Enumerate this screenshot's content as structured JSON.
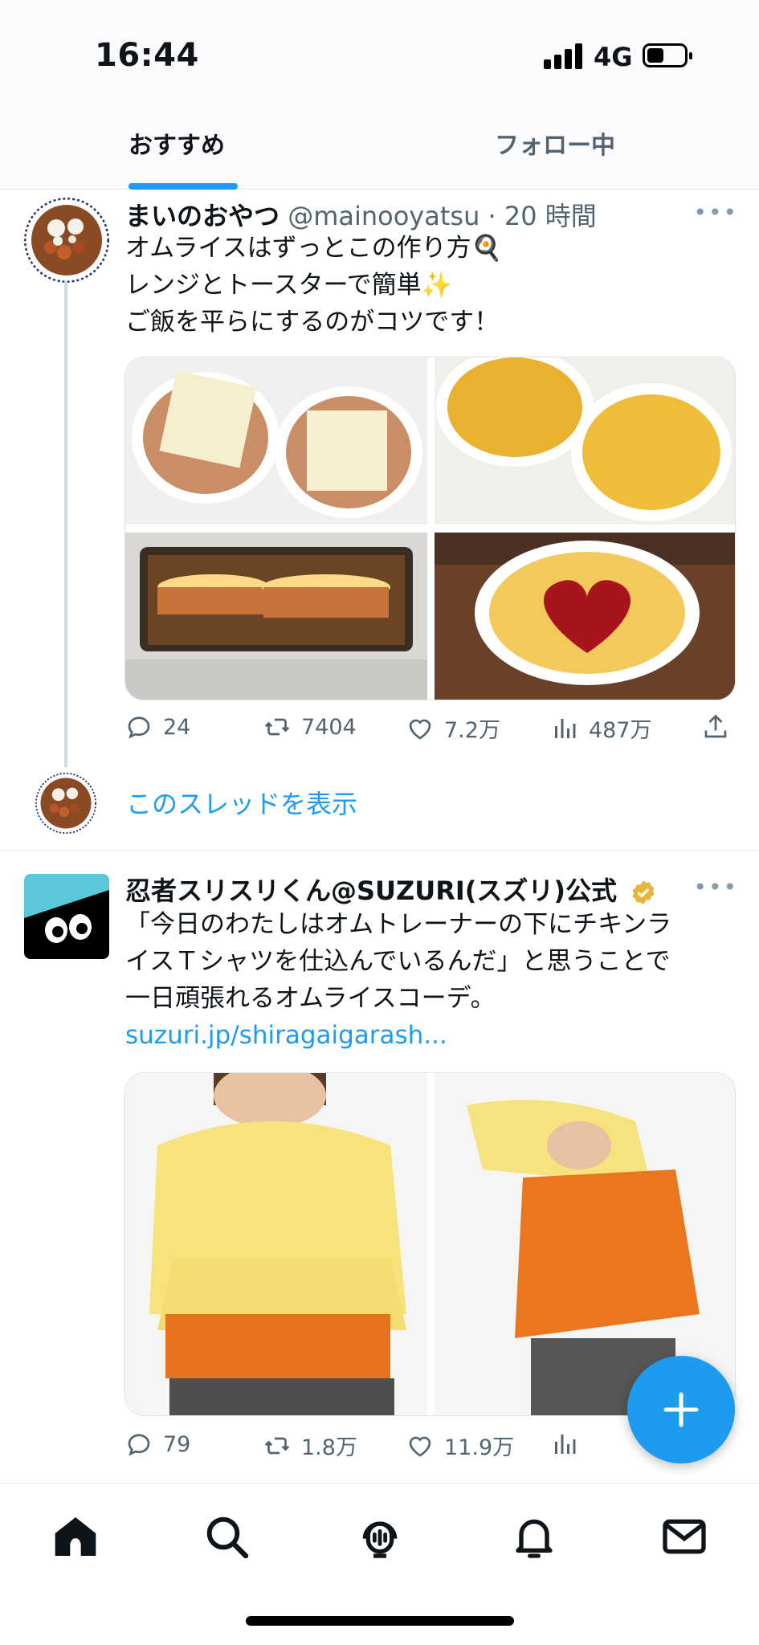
{
  "status_bar": {
    "time": "16:44",
    "network": "4G",
    "battery_level": 0.45
  },
  "tabs": [
    {
      "label": "おすすめ",
      "active": true
    },
    {
      "label": "フォロー中",
      "active": false
    }
  ],
  "tweets": [
    {
      "display_name": "まいのおやつ",
      "handle": "@mainooyatsu",
      "time": "· 20 時間",
      "text_lines": [
        "オムライスはずっとこの作り方🍳",
        "レンジとトースターで簡単✨",
        "ご飯を平らにするのがコツです！"
      ],
      "stats": {
        "replies": "24",
        "retweets": "7404",
        "likes": "7.2万",
        "views": "487万"
      }
    },
    {
      "display_name": "忍者スリスリくん@SUZURI(スズリ)公式",
      "verified": true,
      "text_lines": [
        "「今日のわたしはオムトレーナーの下にチキンラ",
        "イスＴシャツを仕込んでいるんだ」と思うことで",
        "一日頑張れるオムライスコーデ。"
      ],
      "link": "suzuri.jp/shiragaigarash...",
      "stats": {
        "replies": "79",
        "retweets": "1.8万",
        "likes": "11.9万"
      }
    }
  ],
  "thread": {
    "show_label": "このスレッドを表示"
  },
  "icons": {
    "reply": "reply-icon",
    "retweet": "retweet-icon",
    "like": "like-icon",
    "views": "views-icon",
    "share": "share-icon",
    "nav": [
      "home-icon",
      "search-icon",
      "spaces-icon",
      "notifications-icon",
      "messages-icon"
    ]
  },
  "colors": {
    "accent": "#1d9bf0",
    "text": "#0f1419",
    "muted": "#536471"
  }
}
